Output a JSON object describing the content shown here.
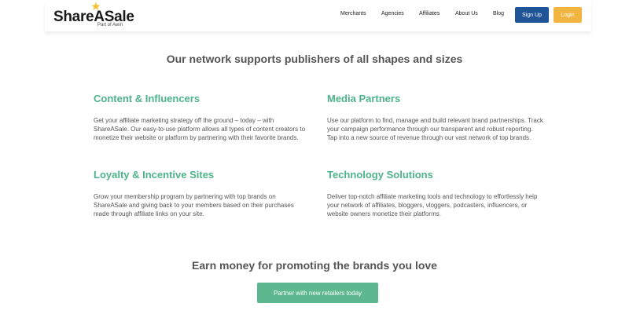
{
  "header": {
    "logo_text": "ShareASale",
    "logo_subtext": "Part of Awin",
    "nav": [
      "Merchants",
      "Agencies",
      "Affiliates",
      "About Us",
      "Blog"
    ],
    "signup_label": "Sign Up",
    "login_label": "Login"
  },
  "main": {
    "headline": "Our network supports publishers of all shapes and sizes",
    "cards": [
      {
        "title": "Content & Influencers",
        "body": "Get your affiliate marketing strategy off the ground – today – with ShareASale. Our easy-to-use platform allows all types of content creators to monetize their website or platform by partnering with their favorite brands."
      },
      {
        "title": "Media Partners",
        "body": "Use our platform to find, manage and build relevant brand partnerships. Track your campaign performance through our transparent and robust reporting. Tap into a new source of revenue through our vast network of top brands."
      },
      {
        "title": "Loyalty & Incentive Sites",
        "body": "Grow your membership program by partnering with top brands on ShareASale and giving back to your members based on their purchases made through affiliate links on your site."
      },
      {
        "title": "Technology Solutions",
        "body": "Deliver top-notch affiliate marketing tools and technology to effortlessly help your network of affiliates, bloggers, vloggers, podcasters, influencers, or website owners monetize their platforms."
      }
    ],
    "cta_headline": "Earn money for promoting the brands you love",
    "cta_button": "Partner with new retailers today"
  },
  "colors": {
    "accent_green": "#4db38a",
    "signup_blue": "#1f5496",
    "login_orange": "#f3b542",
    "cta_green": "#5db88f",
    "logo_star": "#f3c33b"
  },
  "icons": {
    "logo_star": "star-icon"
  }
}
